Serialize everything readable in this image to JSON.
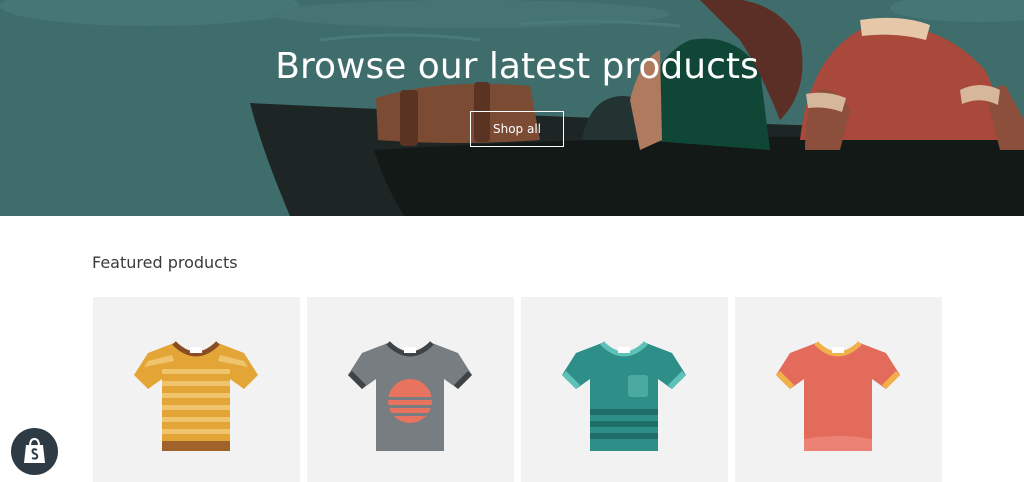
{
  "hero": {
    "title": "Browse our latest products",
    "button_label": "Shop all"
  },
  "featured": {
    "heading": "Featured products",
    "products": [
      {
        "icon": "orange-striped-tshirt-icon",
        "color": "#e3a536"
      },
      {
        "icon": "gray-sunset-tshirt-icon",
        "color": "#777d80"
      },
      {
        "icon": "teal-pocket-tshirt-icon",
        "color": "#2d8f88"
      },
      {
        "icon": "coral-tshirt-icon",
        "color": "#e36b5c"
      }
    ]
  },
  "badge": {
    "icon": "shopify-bag-icon"
  }
}
